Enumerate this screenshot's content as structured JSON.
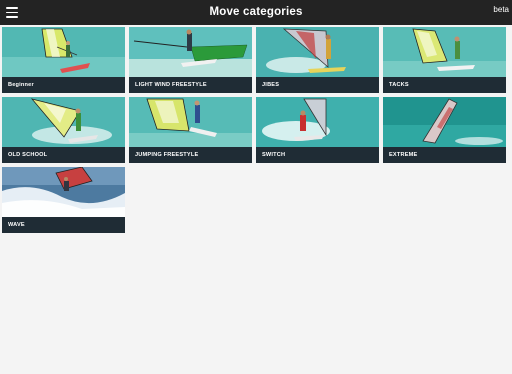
{
  "header": {
    "title": "Move categories",
    "badge": "beta",
    "menu_icon": "hamburger-menu-icon"
  },
  "categories": [
    {
      "label": "Beginner",
      "scene": "shallow"
    },
    {
      "label": "LIGHT WIND FREESTYLE",
      "scene": "shallow"
    },
    {
      "label": "JIBES",
      "scene": "spray"
    },
    {
      "label": "TACKS",
      "scene": "shallow"
    },
    {
      "label": "OLD SCHOOL",
      "scene": "spray"
    },
    {
      "label": "JUMPING FREESTYLE",
      "scene": "shallow"
    },
    {
      "label": "SWITCH",
      "scene": "spray"
    },
    {
      "label": "EXTREME",
      "scene": "deep"
    },
    {
      "label": "WAVE",
      "scene": "wave"
    }
  ]
}
